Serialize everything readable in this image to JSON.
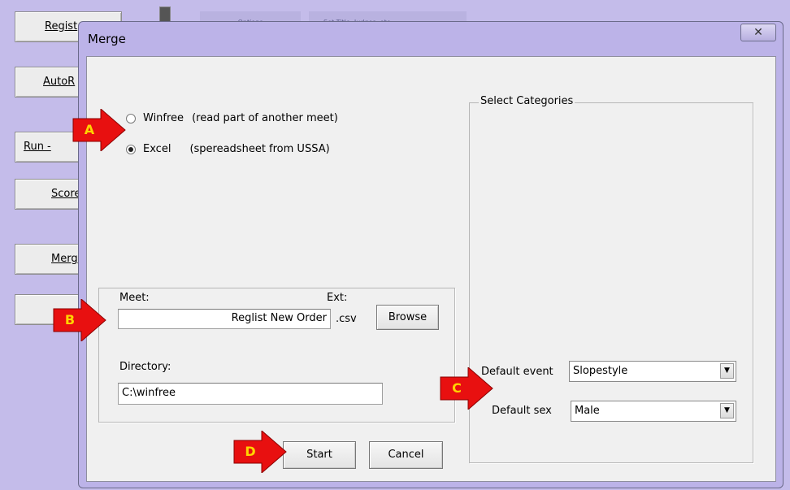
{
  "background": {
    "buttons": [
      "Regist",
      "AutoR",
      "Run -",
      "Score",
      "Merg",
      ""
    ],
    "top_buttons": [
      "Options",
      "Set Title, Judges, etc"
    ]
  },
  "dialog": {
    "title": "Merge",
    "close_glyph": "✕",
    "source": {
      "options": [
        {
          "label": "Winfree",
          "desc": "(read part of another meet)",
          "selected": false
        },
        {
          "label": "Excel",
          "desc": "(spereadsheet from USSA)",
          "selected": true
        }
      ]
    },
    "file": {
      "meet_label": "Meet:",
      "meet_value": "Reglist New Order",
      "ext_label": "Ext:",
      "ext_value": ".csv",
      "browse_label": "Browse",
      "directory_label": "Directory:",
      "directory_value": "C:\\winfree"
    },
    "categories": {
      "legend": "Select Categories",
      "default_event_label": "Default event",
      "default_event_value": "Slopestyle",
      "default_sex_label": "Default sex",
      "default_sex_value": "Male"
    },
    "start_label": "Start",
    "cancel_label": "Cancel"
  },
  "markers": {
    "a": "A",
    "b": "B",
    "c": "C",
    "d": "D"
  },
  "colors": {
    "marker_fill": "#e81010",
    "marker_text": "#ffd400",
    "window_chrome": "#bcb3e8"
  }
}
